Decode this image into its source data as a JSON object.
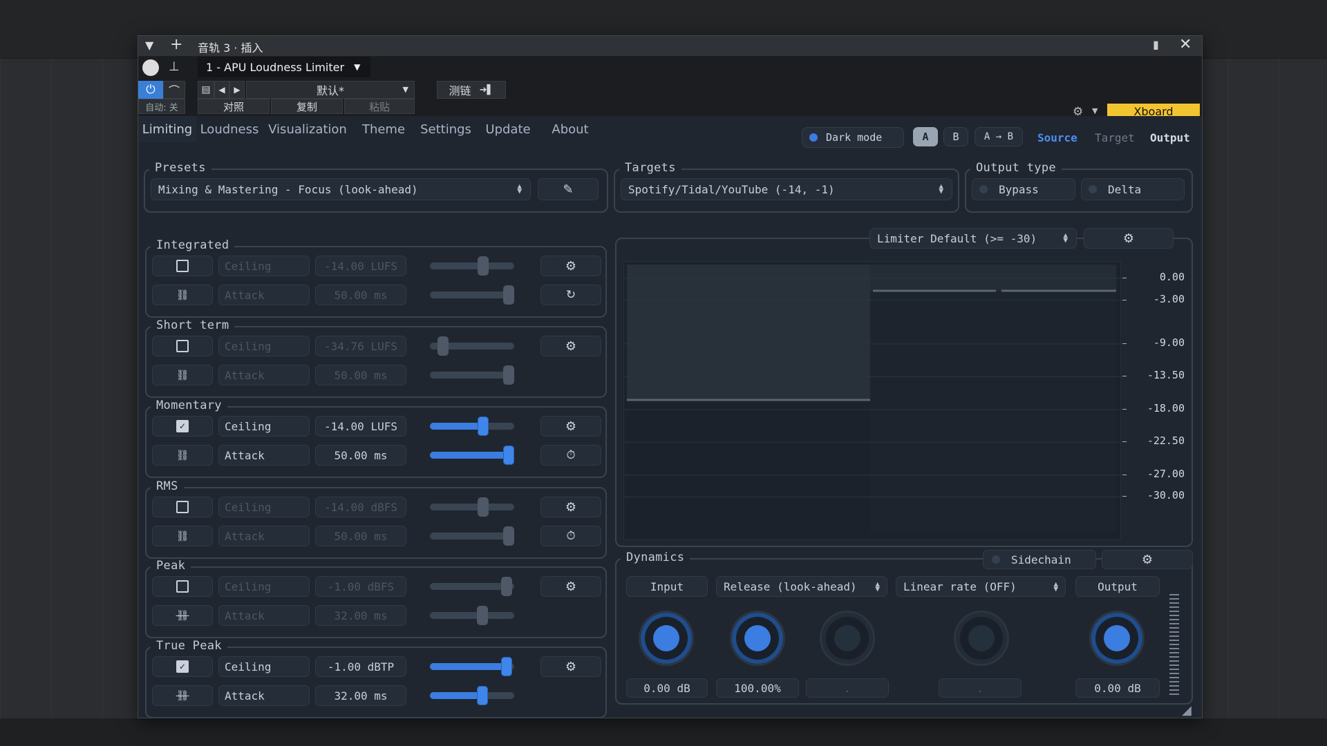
{
  "window": {
    "title": "音轨 3 · 插入"
  },
  "host": {
    "plugin_name": "1 - APU Loudness Limiter",
    "preset_name": "默认*",
    "auto_label": "自动: 关",
    "compare_label": "对照",
    "copy_label": "复制",
    "paste_label": "粘贴",
    "sidechain_label": "测链",
    "xboard_label": "Xboard"
  },
  "tabs": [
    "Limiting",
    "Loudness",
    "Visualization",
    "Theme",
    "Settings",
    "Update",
    "About"
  ],
  "header": {
    "dark_mode_label": "Dark mode",
    "ab_a": "A",
    "ab_b": "B",
    "ab_copy": "A → B",
    "source_label": "Source",
    "target_label": "Target",
    "output_label": "Output"
  },
  "presets": {
    "label": "Presets",
    "value": "Mixing & Mastering - Focus (look-ahead)"
  },
  "targets": {
    "label": "Targets",
    "value": "Spotify/Tidal/YouTube (-14, -1)"
  },
  "output_type": {
    "label": "Output type",
    "bypass": "Bypass",
    "delta": "Delta"
  },
  "sections": [
    {
      "title": "Integrated",
      "enabled": false,
      "ceiling_label": "Ceiling",
      "ceiling_value": "-14.00 LUFS",
      "ceiling_pos": 0.65,
      "attack_label": "Attack",
      "attack_value": "50.00 ms",
      "attack_pos": 1.0,
      "link": true,
      "row2_icon": "reset"
    },
    {
      "title": "Short term",
      "enabled": false,
      "ceiling_label": "Ceiling",
      "ceiling_value": "-34.76 LUFS",
      "ceiling_pos": 0.1,
      "attack_label": "Attack",
      "attack_value": "50.00 ms",
      "attack_pos": 1.0,
      "link": true,
      "row2_icon": ""
    },
    {
      "title": "Momentary",
      "enabled": true,
      "ceiling_label": "Ceiling",
      "ceiling_value": "-14.00 LUFS",
      "ceiling_pos": 0.65,
      "attack_label": "Attack",
      "attack_value": "50.00 ms",
      "attack_pos": 1.0,
      "link": true,
      "row2_icon": "timer"
    },
    {
      "title": "RMS",
      "enabled": false,
      "ceiling_label": "Ceiling",
      "ceiling_value": "-14.00 dBFS",
      "ceiling_pos": 0.65,
      "attack_label": "Attack",
      "attack_value": "50.00 ms",
      "attack_pos": 1.0,
      "link": true,
      "row2_icon": "timer"
    },
    {
      "title": "Peak",
      "enabled": false,
      "ceiling_label": "Ceiling",
      "ceiling_value": "-1.00 dBFS",
      "ceiling_pos": 0.97,
      "attack_label": "Attack",
      "attack_value": "32.00 ms",
      "attack_pos": 0.64,
      "link": false,
      "row2_icon": ""
    },
    {
      "title": "True Peak",
      "enabled": true,
      "ceiling_label": "Ceiling",
      "ceiling_value": "-1.00 dBTP",
      "ceiling_pos": 0.97,
      "attack_label": "Attack",
      "attack_value": "32.00 ms",
      "attack_pos": 0.64,
      "link": false,
      "row2_icon": ""
    }
  ],
  "graph": {
    "mode_value": "Limiter Default (>= -30)",
    "scale": [
      "0.00",
      "-3.00",
      "-9.00",
      "-13.50",
      "-18.00",
      "-22.50",
      "-27.00",
      "-30.00"
    ],
    "scale_db": [
      0,
      -3,
      -9,
      -13.5,
      -18,
      -22.5,
      -27,
      -30
    ]
  },
  "dynamics": {
    "label": "Dynamics",
    "sidechain_label": "Sidechain",
    "input_label": "Input",
    "release_label": "Release (look-ahead)",
    "rate_label": "Linear rate (OFF)",
    "output_label": "Output",
    "input_value": "0.00 dB",
    "release_value": "100.00%",
    "third_value": ".",
    "rate_value": ".",
    "output_value": "0.00 dB"
  },
  "colors": {
    "accent": "#3b7de0",
    "xboard": "#f2c530",
    "source": "#4a8ff0"
  }
}
